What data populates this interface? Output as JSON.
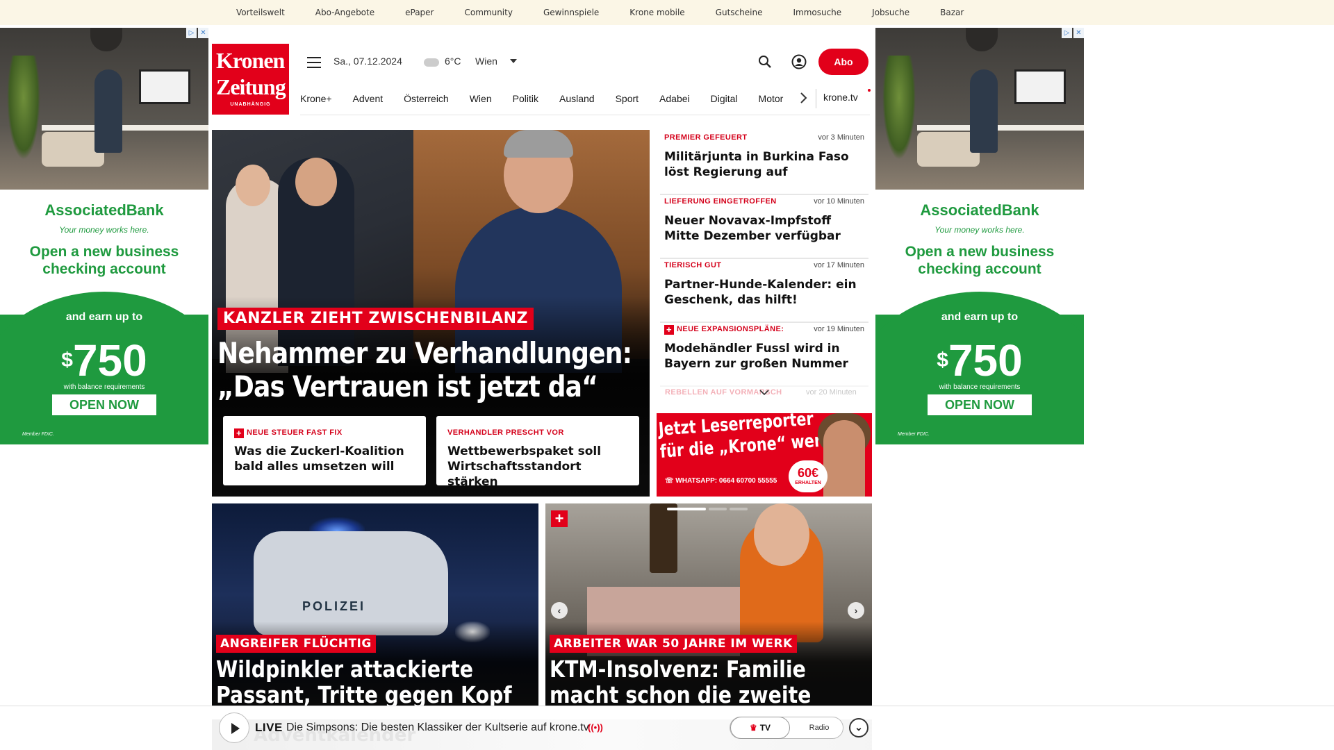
{
  "topbar": {
    "links": [
      "Vorteilswelt",
      "Abo-Angebote",
      "ePaper",
      "Community",
      "Gewinnspiele",
      "Krone mobile",
      "Gutscheine",
      "Immosuche",
      "Jobsuche",
      "Bazar"
    ]
  },
  "ad": {
    "brand": "AssociatedBank",
    "tagline": "Your money works here.",
    "headline": "Open a new business checking account",
    "earn": "and earn up to",
    "amount_symbol": "$",
    "amount": "750",
    "requirement": "with balance requirements",
    "cta": "OPEN NOW",
    "fdic": "Member FDIC.",
    "brand_color": "#1f9a3f"
  },
  "header": {
    "logo_line1": "Kronen",
    "logo_line2": "Zeitung",
    "logo_line3": "UNABHÄNGIG",
    "date": "Sa., 07.12.2024",
    "temperature": "6°C",
    "city": "Wien",
    "abo_label": "Abo",
    "accent_color": "#e2001a"
  },
  "nav": {
    "items": [
      "Krone+",
      "Advent",
      "Österreich",
      "Wien",
      "Politik",
      "Ausland",
      "Sport",
      "Adabei",
      "Digital",
      "Motor"
    ],
    "tv": "krone.tv"
  },
  "hero": {
    "kicker": "KANZLER ZIEHT ZWISCHENBILANZ",
    "title_line1": "Nehammer zu Verhandlungen:",
    "title_line2": "„Das Vertrauen ist jetzt da“",
    "sub": [
      {
        "kicker": "NEUE STEUER FAST FIX",
        "title": "Was die Zuckerl-Koalition bald alles umsetzen will"
      },
      {
        "kicker": "VERHANDLER PRESCHT VOR",
        "title": "Wettbewerbspaket soll Wirtschaftsstandort stärken"
      }
    ]
  },
  "ticker": {
    "items": [
      {
        "kicker": "PREMIER GEFEUERT",
        "time": "vor 3 Minuten",
        "title": "Militärjunta in Burkina Faso löst Regierung auf",
        "plus": false
      },
      {
        "kicker": "LIEFERUNG EINGETROFFEN",
        "time": "vor 10 Minuten",
        "title": "Neuer Novavax-Impfstoff Mitte Dezember verfügbar",
        "plus": false
      },
      {
        "kicker": "TIERISCH GUT",
        "time": "vor 17 Minuten",
        "title": "Partner-Hunde-Kalender: ein Geschenk, das hilft!",
        "plus": false
      },
      {
        "kicker": "NEUE EXPANSIONSPLÄNE:",
        "time": "vor 19 Minuten",
        "title": "Modehändler Fussl wird in Bayern zur großen Nummer",
        "plus": true
      }
    ],
    "faded_kicker": "REBELLEN AUF VORMARSCH",
    "faded_time": "vor 20 Minuten"
  },
  "reporter": {
    "line1": "Jetzt Leserreporter",
    "line2": "für die „Krone“ werden",
    "whatsapp": "WHATSAPP: 0664 60700 55555",
    "badge": "60€",
    "badge_sub": "ERHALTEN"
  },
  "cards": [
    {
      "kicker": "ANGREIFER FLÜCHTIG",
      "title": "Wildpinkler attackierte Passant, Tritte gegen Kopf",
      "image_text": "POLIZEI"
    },
    {
      "kicker": "ARBEITER WAR 50 JAHRE IM WERK",
      "title": "KTM-Insolvenz: Familie macht schon die zweite Pleite mit"
    }
  ],
  "player": {
    "live_label": "LIVE",
    "text": "Die Simpsons: Die besten Klassiker der Kultserie auf krone.tv",
    "tv_label": "TV",
    "radio_label": "Radio",
    "behind_text": "Adventkalender"
  }
}
